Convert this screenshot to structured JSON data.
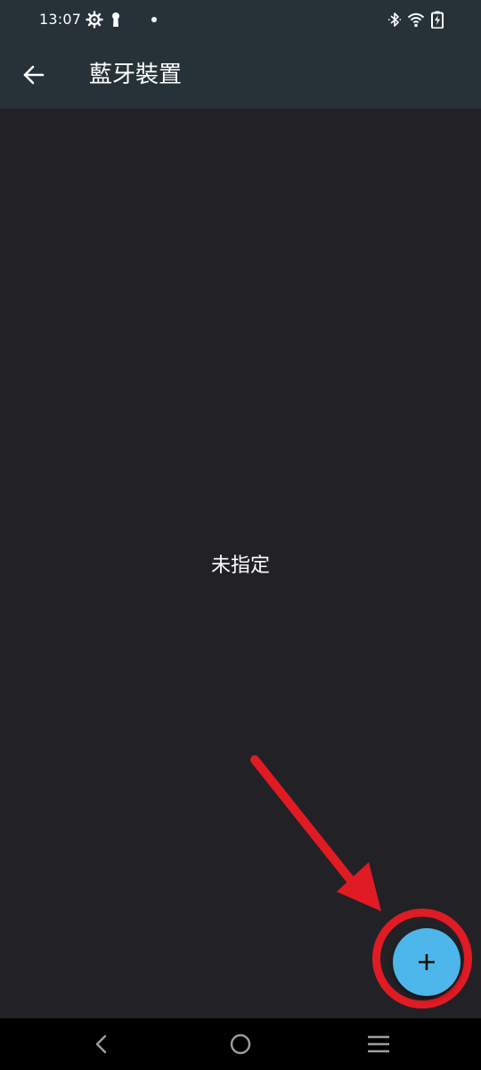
{
  "status_bar": {
    "time": "13:07",
    "icons": [
      "settings-gear-icon",
      "keyhole-icon",
      "notification-dot-icon",
      "bluetooth-icon",
      "wifi-icon",
      "battery-charging-icon"
    ]
  },
  "app_bar": {
    "title": "藍牙裝置",
    "back_icon": "arrow-back-icon"
  },
  "main": {
    "empty_text": "未指定"
  },
  "fab": {
    "icon": "plus-icon"
  },
  "annotation": {
    "color": "#e01b24"
  },
  "nav_bar": {
    "icons": [
      "nav-back-icon",
      "nav-home-icon",
      "nav-menu-icon"
    ]
  },
  "colors": {
    "app_bar": "#263238",
    "background": "#222226",
    "fab": "#4db6ea",
    "annotation": "#e01b24"
  }
}
